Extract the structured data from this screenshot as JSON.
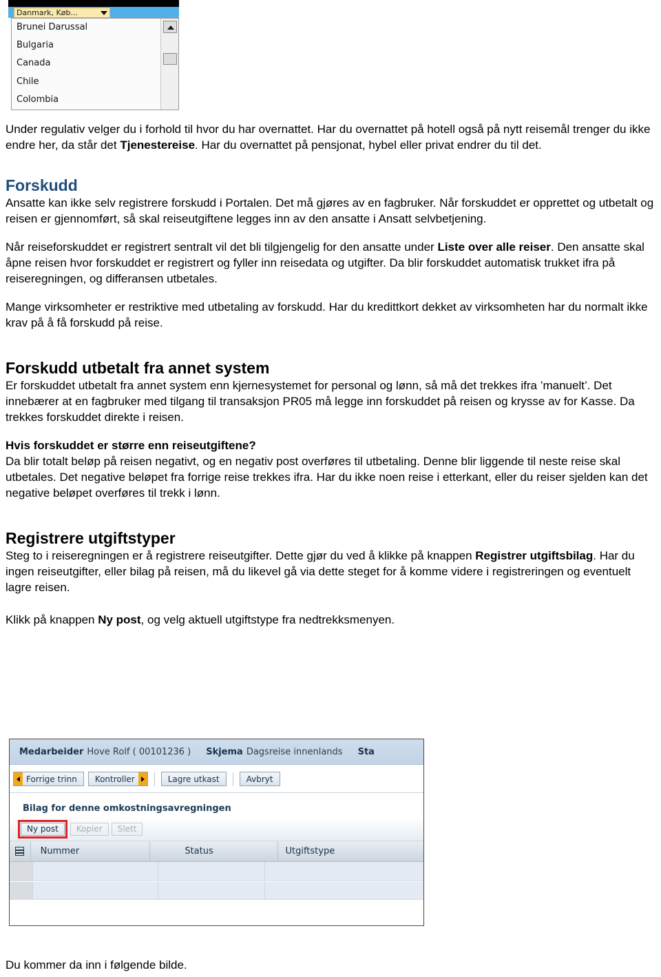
{
  "top_screenshot": {
    "combo": {
      "value": "Danmark, Køb...",
      "arrow_icon": "chevron-down-icon"
    },
    "listbox": {
      "options": [
        "Brunei Darussal",
        "Bulgaria",
        "Canada",
        "Chile",
        "Colombia"
      ],
      "scroll_up_icon": "scroll-up-arrow-icon"
    }
  },
  "document": {
    "para_regulativ": {
      "t1": "Under regulativ velger du i forhold til hvor du har overnattet. Har du overnattet på hotell også på nytt reisemål trenger du ikke endre her, da står det ",
      "bold1": "Tjenestereise",
      "t2": ". Har du overnattet på pensjonat, hybel eller privat endrer du til det."
    },
    "heading_forskudd": "Forskudd",
    "para_forskudd_1": "Ansatte kan ikke selv registrere forskudd i Portalen. Det må gjøres av en fagbruker. Når forskuddet er opprettet og utbetalt og reisen er gjennomført, så skal reiseutgiftene legges inn av den ansatte i Ansatt selvbetjening.",
    "para_forskudd_2": {
      "t1": "Når reiseforskuddet er registrert sentralt vil det bli tilgjengelig for den ansatte under ",
      "bold1": "Liste over alle reiser",
      "t2": ". Den ansatte skal åpne reisen hvor forskuddet er registrert og fyller inn reisedata og utgifter. Da blir forskuddet automatisk trukket ifra på reiseregningen, og differansen utbetales."
    },
    "para_forskudd_3": "Mange virksomheter er restriktive med utbetaling av forskudd. Har du kredittkort dekket av virksomheten har du normalt ikke krav på å få forskudd på reise.",
    "heading_annet_system": "Forskudd utbetalt fra annet system",
    "para_annet_system": "Er forskuddet utbetalt fra annet system enn kjernesystemet for personal og lønn, så må det trekkes ifra ’manuelt’. Det innebærer at en fagbruker med tilgang til transaksjon PR05 må legge inn forskuddet på reisen og krysse av for Kasse. Da trekkes forskuddet direkte i reisen.",
    "subheading_storre": "Hvis forskuddet er større enn reiseutgiftene?",
    "para_storre": "Da blir totalt beløp på reisen negativt, og en negativ post overføres til utbetaling. Denne blir liggende til neste reise skal utbetales. Det negative beløpet fra forrige reise trekkes ifra. Har du ikke noen reise i etterkant, eller du reiser sjelden kan det negative beløpet overføres til trekk i lønn.",
    "heading_registrere": "Registrere utgiftstyper",
    "para_registrere": {
      "t1": "Steg to i reiseregningen er å registrere reiseutgifter. Dette gjør du ved å klikke på knappen ",
      "bold1": "Registrer utgiftsbilag",
      "t2": ". Har du ingen reiseutgifter, eller bilag på reisen, må du likevel gå via dette steget for å komme videre i registreringen og eventuelt lagre reisen."
    },
    "para_ny_post": {
      "t1": "Klikk på knappen ",
      "bold1": "Ny post",
      "t2": ", og velg aktuell utgiftstype fra nedtrekksmenyen."
    },
    "caption_bottom": "Du kommer da inn i følgende bilde."
  },
  "bottom_screenshot": {
    "header": {
      "employee_label": "Medarbeider",
      "employee_value": "Hove Rolf ( 00101236 )",
      "form_label": "Skjema",
      "form_value": "Dagsreise innenlands",
      "status_label": "Sta"
    },
    "toolbar": {
      "prev_step": "Forrige trinn",
      "check": "Kontroller",
      "save_draft": "Lagre utkast",
      "cancel": "Avbryt"
    },
    "section_title": "Bilag for denne omkostningsavregningen",
    "subtoolbar": {
      "new_post": "Ny post",
      "copy": "Kopier",
      "delete": "Slett"
    },
    "table": {
      "columns": [
        "Nummer",
        "Status",
        "Utgiftstype"
      ],
      "rows": [
        [],
        []
      ]
    },
    "colors": {
      "highlight_box": "#e02020",
      "header_bar": "#c6d6e6",
      "arrow_accent": "#f4a81d"
    }
  }
}
